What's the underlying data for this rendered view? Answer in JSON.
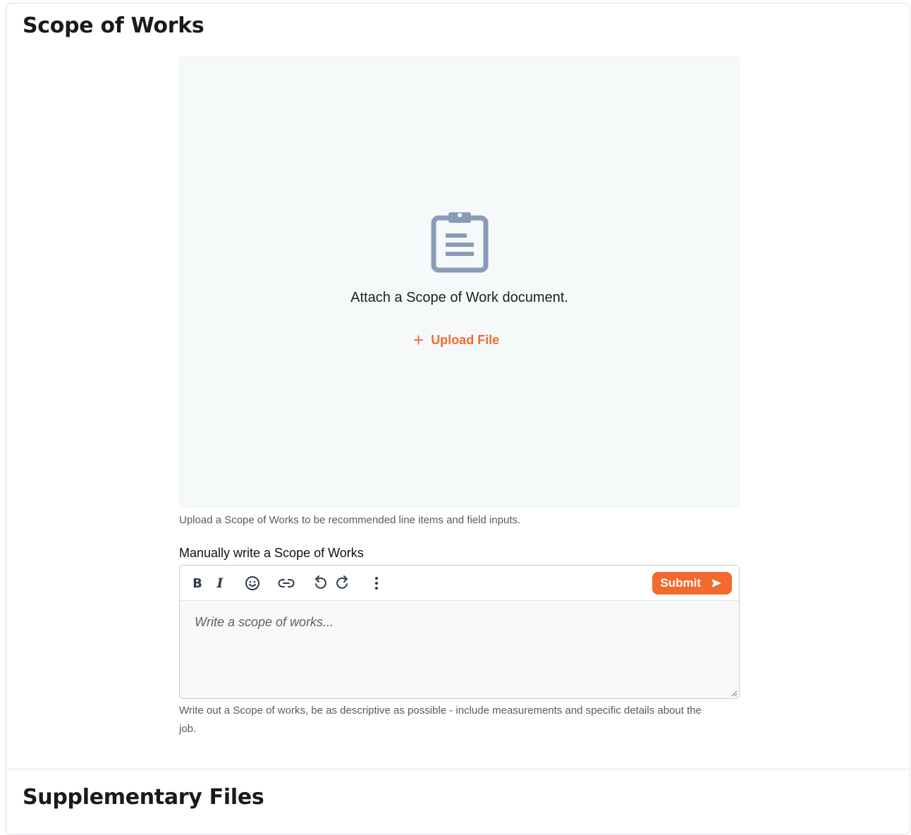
{
  "scope_section": {
    "title": "Scope of Works",
    "dropzone": {
      "icon": "clipboard-icon",
      "prompt": "Attach a Scope of Work document.",
      "upload_label": "Upload File",
      "help": "Upload a Scope of Works to be recommended line items and field inputs."
    },
    "editor": {
      "label": "Manually write a Scope of Works",
      "toolbar": {
        "bold": "B",
        "italic": "I",
        "submit_label": "Submit"
      },
      "placeholder": "Write a scope of works...",
      "value": "",
      "help": "Write out a Scope of works, be as descriptive as possible - include measurements and specific details about the job."
    }
  },
  "supplementary_section": {
    "title": "Supplementary Files"
  },
  "colors": {
    "accent": "#f26a2e",
    "icon_muted": "#8a9ab8",
    "dropzone_bg": "#f5f9fa",
    "toolbar_icon": "#2f3b4d"
  }
}
